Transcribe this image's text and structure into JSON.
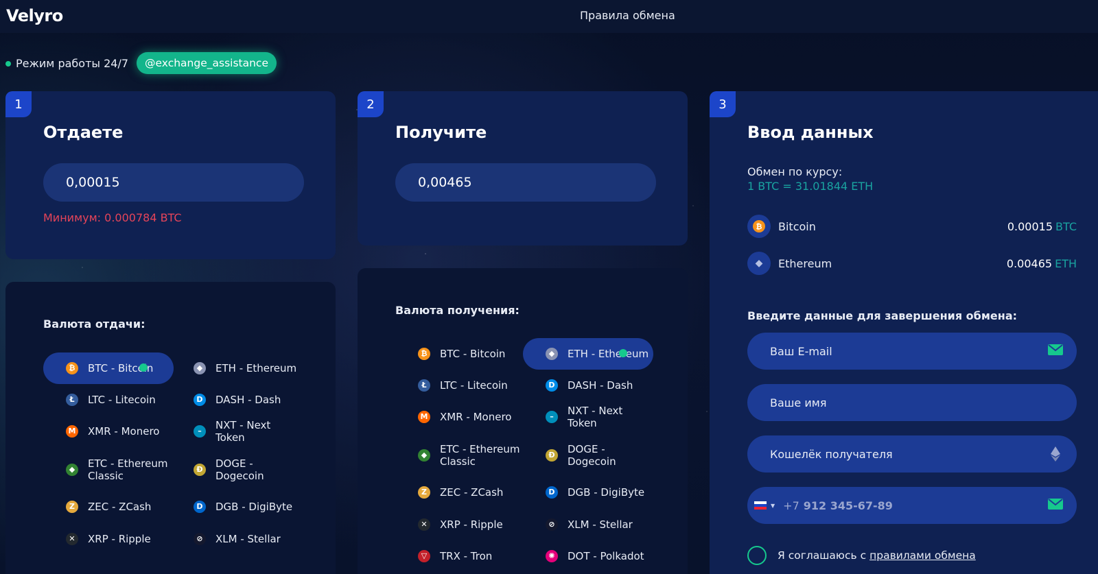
{
  "header": {
    "logo": "Velyro",
    "rules_link": "Правила обмена"
  },
  "status": {
    "work_mode": "Режим работы 24/7",
    "telegram": "@exchange_assistance"
  },
  "give": {
    "step": "1",
    "title": "Отдаете",
    "amount": "0,00015",
    "minimum": "Минимум: 0.000784 BTC",
    "list_title": "Валюта отдачи:"
  },
  "receive": {
    "step": "2",
    "title": "Получите",
    "amount": "0,00465",
    "list_title": "Валюта получения:"
  },
  "coins": [
    {
      "label": "BTC - Bitcoin",
      "icon": "bitcoin-icon",
      "color": "#f7931a",
      "glyph": "₿"
    },
    {
      "label": "ETH - Ethereum",
      "icon": "ethereum-icon",
      "color": "#8a93b2",
      "glyph": "◆"
    },
    {
      "label": "LTC - Litecoin",
      "icon": "litecoin-icon",
      "color": "#345d9d",
      "glyph": "Ł"
    },
    {
      "label": "DASH - Dash",
      "icon": "dash-icon",
      "color": "#008ce7",
      "glyph": "D"
    },
    {
      "label": "XMR - Monero",
      "icon": "monero-icon",
      "color": "#ff6600",
      "glyph": "M"
    },
    {
      "label": "NXT - Next Token",
      "icon": "nxt-icon",
      "color": "#008fbb",
      "glyph": "–"
    },
    {
      "label": "ETC - Ethereum Classic",
      "icon": "ethereum-classic-icon",
      "color": "#328332",
      "glyph": "◆"
    },
    {
      "label": "DOGE - Dogecoin",
      "icon": "dogecoin-icon",
      "color": "#c2a633",
      "glyph": "Ð"
    },
    {
      "label": "ZEC - ZCash",
      "icon": "zcash-icon",
      "color": "#e5a93d",
      "glyph": "Z"
    },
    {
      "label": "DGB - DigiByte",
      "icon": "digibyte-icon",
      "color": "#0066cc",
      "glyph": "D"
    },
    {
      "label": "XRP - Ripple",
      "icon": "ripple-icon",
      "color": "#23292f",
      "glyph": "✕"
    },
    {
      "label": "XLM - Stellar",
      "icon": "stellar-icon",
      "color": "#14182e",
      "glyph": "⊘"
    },
    {
      "label": "TRX - Tron",
      "icon": "tron-icon",
      "color": "#c4202a",
      "glyph": "▽"
    },
    {
      "label": "DOT - Polkadot",
      "icon": "polkadot-icon",
      "color": "#e6007a",
      "glyph": "✺"
    }
  ],
  "details": {
    "step": "3",
    "title": "Ввод данных",
    "rate_label": "Обмен по курсу:",
    "rate_value": "1 BTC = 31.01844 ETH",
    "from_name": "Bitcoin",
    "from_amount": "0.00015",
    "from_currency": "BTC",
    "to_name": "Ethereum",
    "to_amount": "0.00465",
    "to_currency": "ETH",
    "form_title": "Введите данные для завершения обмена:",
    "email_placeholder": "Ваш E-mail",
    "name_placeholder": "Ваше имя",
    "wallet_placeholder": "Кошелёк получателя",
    "phone_code": "+7",
    "phone_value": "912 345-67-89",
    "agree_text": "Я соглашаюсь с",
    "agree_link": "правилами обмена"
  },
  "colors": {
    "accent": "#16c98d",
    "panel": "#0f2152",
    "selected": "#1c3b95",
    "error": "#e64459"
  }
}
